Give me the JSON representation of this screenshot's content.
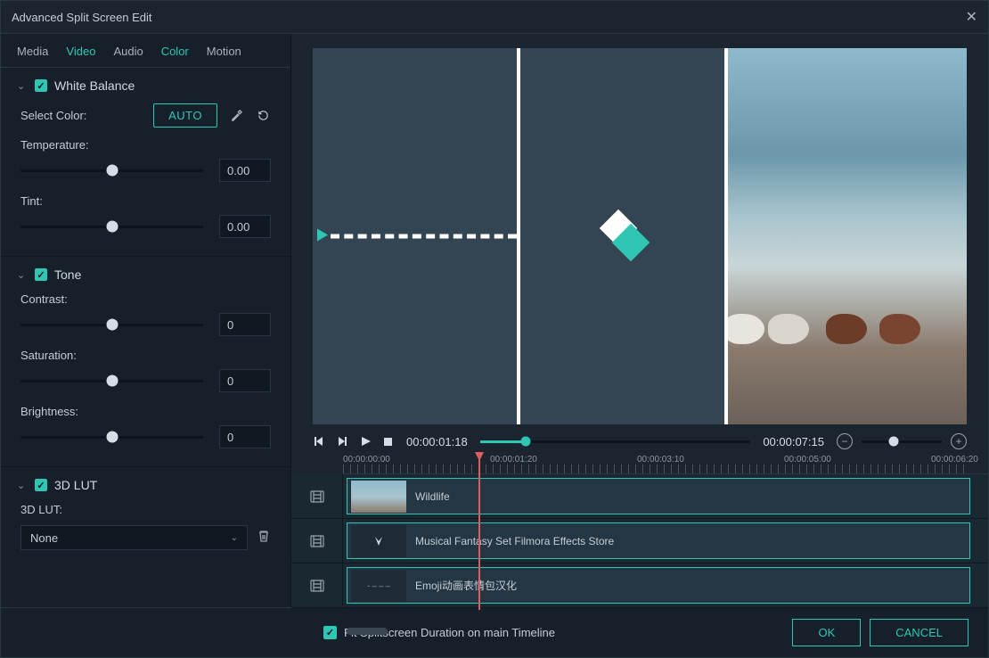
{
  "window": {
    "title": "Advanced Split Screen Edit"
  },
  "tabs": [
    "Media",
    "Video",
    "Audio",
    "Color",
    "Motion"
  ],
  "activeTab": "Color",
  "sections": {
    "whiteBalance": {
      "title": "White Balance",
      "selectColorLabel": "Select Color:",
      "autoLabel": "AUTO",
      "temperature": {
        "label": "Temperature:",
        "value": "0.00"
      },
      "tint": {
        "label": "Tint:",
        "value": "0.00"
      }
    },
    "tone": {
      "title": "Tone",
      "contrast": {
        "label": "Contrast:",
        "value": "0"
      },
      "saturation": {
        "label": "Saturation:",
        "value": "0"
      },
      "brightness": {
        "label": "Brightness:",
        "value": "0"
      }
    },
    "lut": {
      "title": "3D LUT",
      "label": "3D LUT:",
      "selected": "None"
    }
  },
  "playback": {
    "current": "00:00:01:18",
    "total": "00:00:07:15"
  },
  "ruler": [
    "00:00:00:00",
    "00:00:01:20",
    "00:00:03:10",
    "00:00:05:00",
    "00:00:06:20"
  ],
  "tracks": [
    {
      "name": "Wildlife",
      "thumbType": "beach"
    },
    {
      "name": "Musical Fantasy Set Filmora Effects Store",
      "thumbType": "dark-shape"
    },
    {
      "name": "Emoji动画表情包汉化",
      "thumbType": "dark-dash"
    }
  ],
  "footer": {
    "fitLabel": "Fit Splitscreen Duration on main Timeline",
    "ok": "OK",
    "cancel": "CANCEL"
  }
}
